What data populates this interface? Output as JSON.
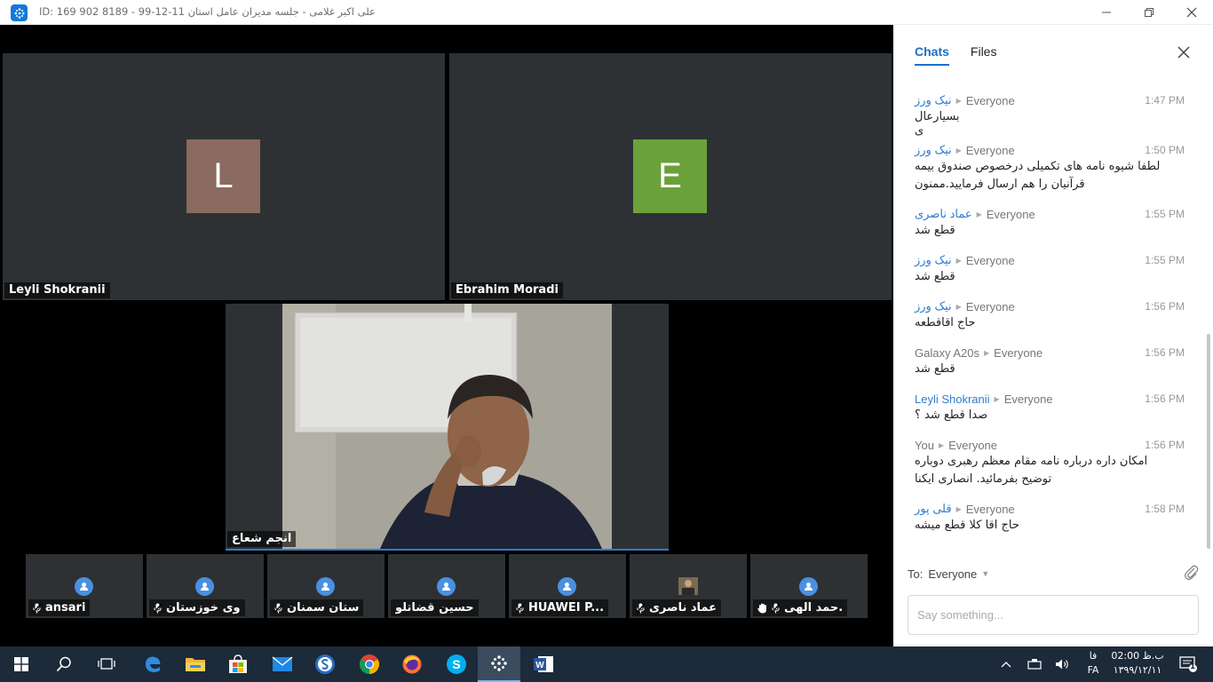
{
  "window": {
    "title": "ID: 169 902 8189 - علی اکبر غلامی - جلسه مدیران عامل استان 11-12-99"
  },
  "video": {
    "tiles": [
      {
        "name": "Leyli Shokranii",
        "initial": "L",
        "color": "#8b6b60"
      },
      {
        "name": "Ebrahim Moradi",
        "initial": "E",
        "color": "#6ba13a"
      }
    ],
    "active_speaker": {
      "name": "انجم شعاع"
    },
    "thumbnails": [
      {
        "name": "ansari",
        "muted": true
      },
      {
        "name": "وی خوزستان",
        "muted": true
      },
      {
        "name": "ستان سمنان",
        "muted": true
      },
      {
        "name": "حسین قضاتلو",
        "muted": false
      },
      {
        "name": "HUAWEI P...",
        "muted": true
      },
      {
        "name": "عماد ناصری",
        "muted": true,
        "photo": true
      },
      {
        "name": "حمد الهی.",
        "muted": true,
        "hand_raised": true
      }
    ]
  },
  "chat": {
    "tabs": [
      "Chats",
      "Files"
    ],
    "active_tab": "Chats",
    "messages": [
      {
        "sender": "نیک ورز",
        "to": "Everyone",
        "time": "1:47 PM",
        "lines": [
          "بسیارعال",
          "ی"
        ]
      },
      {
        "sender": "نیک ورز",
        "to": "Everyone",
        "time": "1:50 PM",
        "lines": [
          "لطفا شیوه نامه های تکمیلی درخصوص صندوق بیمه",
          "قرآنیان را هم ارسال فرمایید.ممنون"
        ]
      },
      {
        "sender": "عماد ناصری",
        "to": "Everyone",
        "time": "1:55 PM",
        "lines": [
          "قطع شد"
        ]
      },
      {
        "sender": "نیک ورز",
        "to": "Everyone",
        "time": "1:55 PM",
        "lines": [
          "قطع شد"
        ]
      },
      {
        "sender": "نیک ورز",
        "to": "Everyone",
        "time": "1:56 PM",
        "lines": [
          "حاج اقاقطعه"
        ]
      },
      {
        "sender": "Galaxy A20s",
        "to": "Everyone",
        "time": "1:56 PM",
        "lines": [
          "قطع شد"
        ],
        "grey": true
      },
      {
        "sender": "Leyli Shokranii",
        "to": "Everyone",
        "time": "1:56 PM",
        "lines": [
          "صدا قطع شد ؟"
        ]
      },
      {
        "sender": "You",
        "to": "Everyone",
        "time": "1:56 PM",
        "lines": [
          "امکان داره درباره نامه مقام معظم رهبری دوباره",
          "توضیح بفرمائید. انصاری ایکنا"
        ],
        "grey": true
      },
      {
        "sender": "قلی پور",
        "to": "Everyone",
        "time": "1:58 PM",
        "lines": [
          "حاج اقا کلا قطع میشه"
        ]
      }
    ],
    "to_label": "To:",
    "to_value": "Everyone",
    "input_placeholder": "Say something..."
  },
  "taskbar": {
    "icons": [
      "windows-start-icon",
      "search-icon",
      "task-view-icon",
      "edge-icon",
      "file-explorer-icon",
      "store-icon",
      "mail-icon",
      "app-s-icon",
      "chrome-icon",
      "firefox-icon",
      "skype-icon",
      "meeting-app-icon",
      "word-icon"
    ],
    "language": "فا",
    "language_code": "FA",
    "time": "02:00 ب.ظ",
    "date": "۱۳۹۹/۱۲/۱۱",
    "notification_count": "1"
  }
}
